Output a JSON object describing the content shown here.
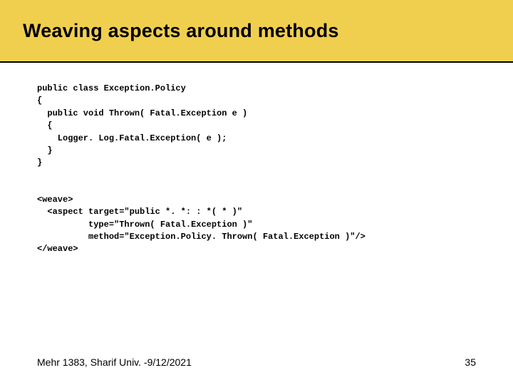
{
  "title": "Weaving aspects around methods",
  "code1": "public class Exception.Policy\n{\n  public void Thrown( Fatal.Exception e )\n  {\n    Logger. Log.Fatal.Exception( e );\n  }\n}",
  "code2": "<weave>\n  <aspect target=\"public *. *: : *( * )\"\n          type=\"Thrown( Fatal.Exception )\"\n          method=\"Exception.Policy. Thrown( Fatal.Exception )\"/>\n</weave>",
  "footer": {
    "left": "Mehr 1383,  Sharif Univ. -9/12/2021",
    "page": "35"
  }
}
